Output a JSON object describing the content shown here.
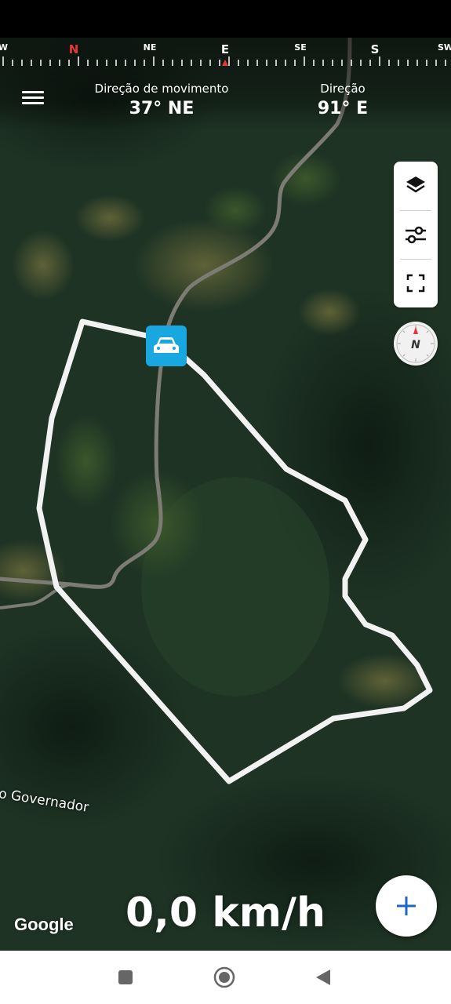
{
  "compass": {
    "letters": [
      "W",
      "N",
      "NE",
      "E",
      "SE",
      "S",
      "SW"
    ],
    "accent_color": "#e53935"
  },
  "header": {
    "movement_label": "Direção de movimento",
    "movement_value": "37° NE",
    "heading_label": "Direção",
    "heading_value": "91° E"
  },
  "map": {
    "place_label": "o Governador",
    "attribution": "Google",
    "marker_icon": "car-icon",
    "marker_color": "#19a7e0",
    "boundary_color": "#ffffff"
  },
  "controls": {
    "layers_icon": "layers-icon",
    "filters_icon": "sliders-icon",
    "fullscreen_icon": "fullscreen-icon",
    "compass_icon": "compass-icon",
    "compass_letter": "N"
  },
  "speed": "0,0 km/h",
  "fab_icon": "plus-icon",
  "system_nav": {
    "icons": [
      "recents-icon",
      "home-icon",
      "back-icon"
    ]
  }
}
